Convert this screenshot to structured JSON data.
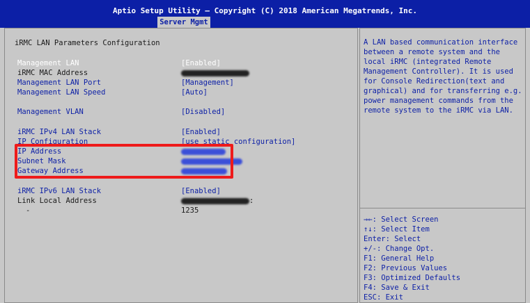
{
  "header": {
    "title": "Aptio Setup Utility – Copyright (C) 2018 American Megatrends, Inc.",
    "tab": "Server Mgmt"
  },
  "colors": {
    "header_bg": "#0c1fa6",
    "highlight_box": "#ee1b1b",
    "selected_text": "#ffffff"
  },
  "section_title": "iRMC LAN Parameters Configuration",
  "settings": {
    "management_lan": {
      "label": "Management LAN",
      "value": "[Enabled]"
    },
    "mac_address": {
      "label": "iRMC MAC Address"
    },
    "lan_port": {
      "label": "Management LAN Port",
      "value": "[Management]"
    },
    "lan_speed": {
      "label": "Management LAN Speed",
      "value": "[Auto]"
    },
    "vlan": {
      "label": "Management VLAN",
      "value": "[Disabled]"
    },
    "ipv4_stack": {
      "label": "iRMC IPv4 LAN Stack",
      "value": "[Enabled]"
    },
    "ip_config": {
      "label": "IP Configuration",
      "value": "[use static configuration]"
    },
    "ip_address": {
      "label": "IP Address"
    },
    "subnet_mask": {
      "label": "Subnet Mask"
    },
    "gateway": {
      "label": "Gateway Address"
    },
    "ipv6_stack": {
      "label": "iRMC IPv6 LAN Stack",
      "value": "[Enabled]"
    },
    "link_local": {
      "label": "Link Local Address",
      "value_suffix": ":"
    },
    "prefix": {
      "label": "-",
      "value": "1235"
    }
  },
  "help_text": "A LAN based communication interface between a remote system and the local iRMC (integrated Remote Management Controller). It is used for Console Redirection(text and graphical) and for transferring e.g. power management commands from the remote system to the iRMC via LAN.",
  "key_help": [
    "→←: Select Screen",
    "↑↓: Select Item",
    "Enter: Select",
    "+/-: Change Opt.",
    "F1: General Help",
    "F2: Previous Values",
    "F3: Optimized Defaults",
    "F4: Save & Exit",
    "ESC: Exit"
  ]
}
